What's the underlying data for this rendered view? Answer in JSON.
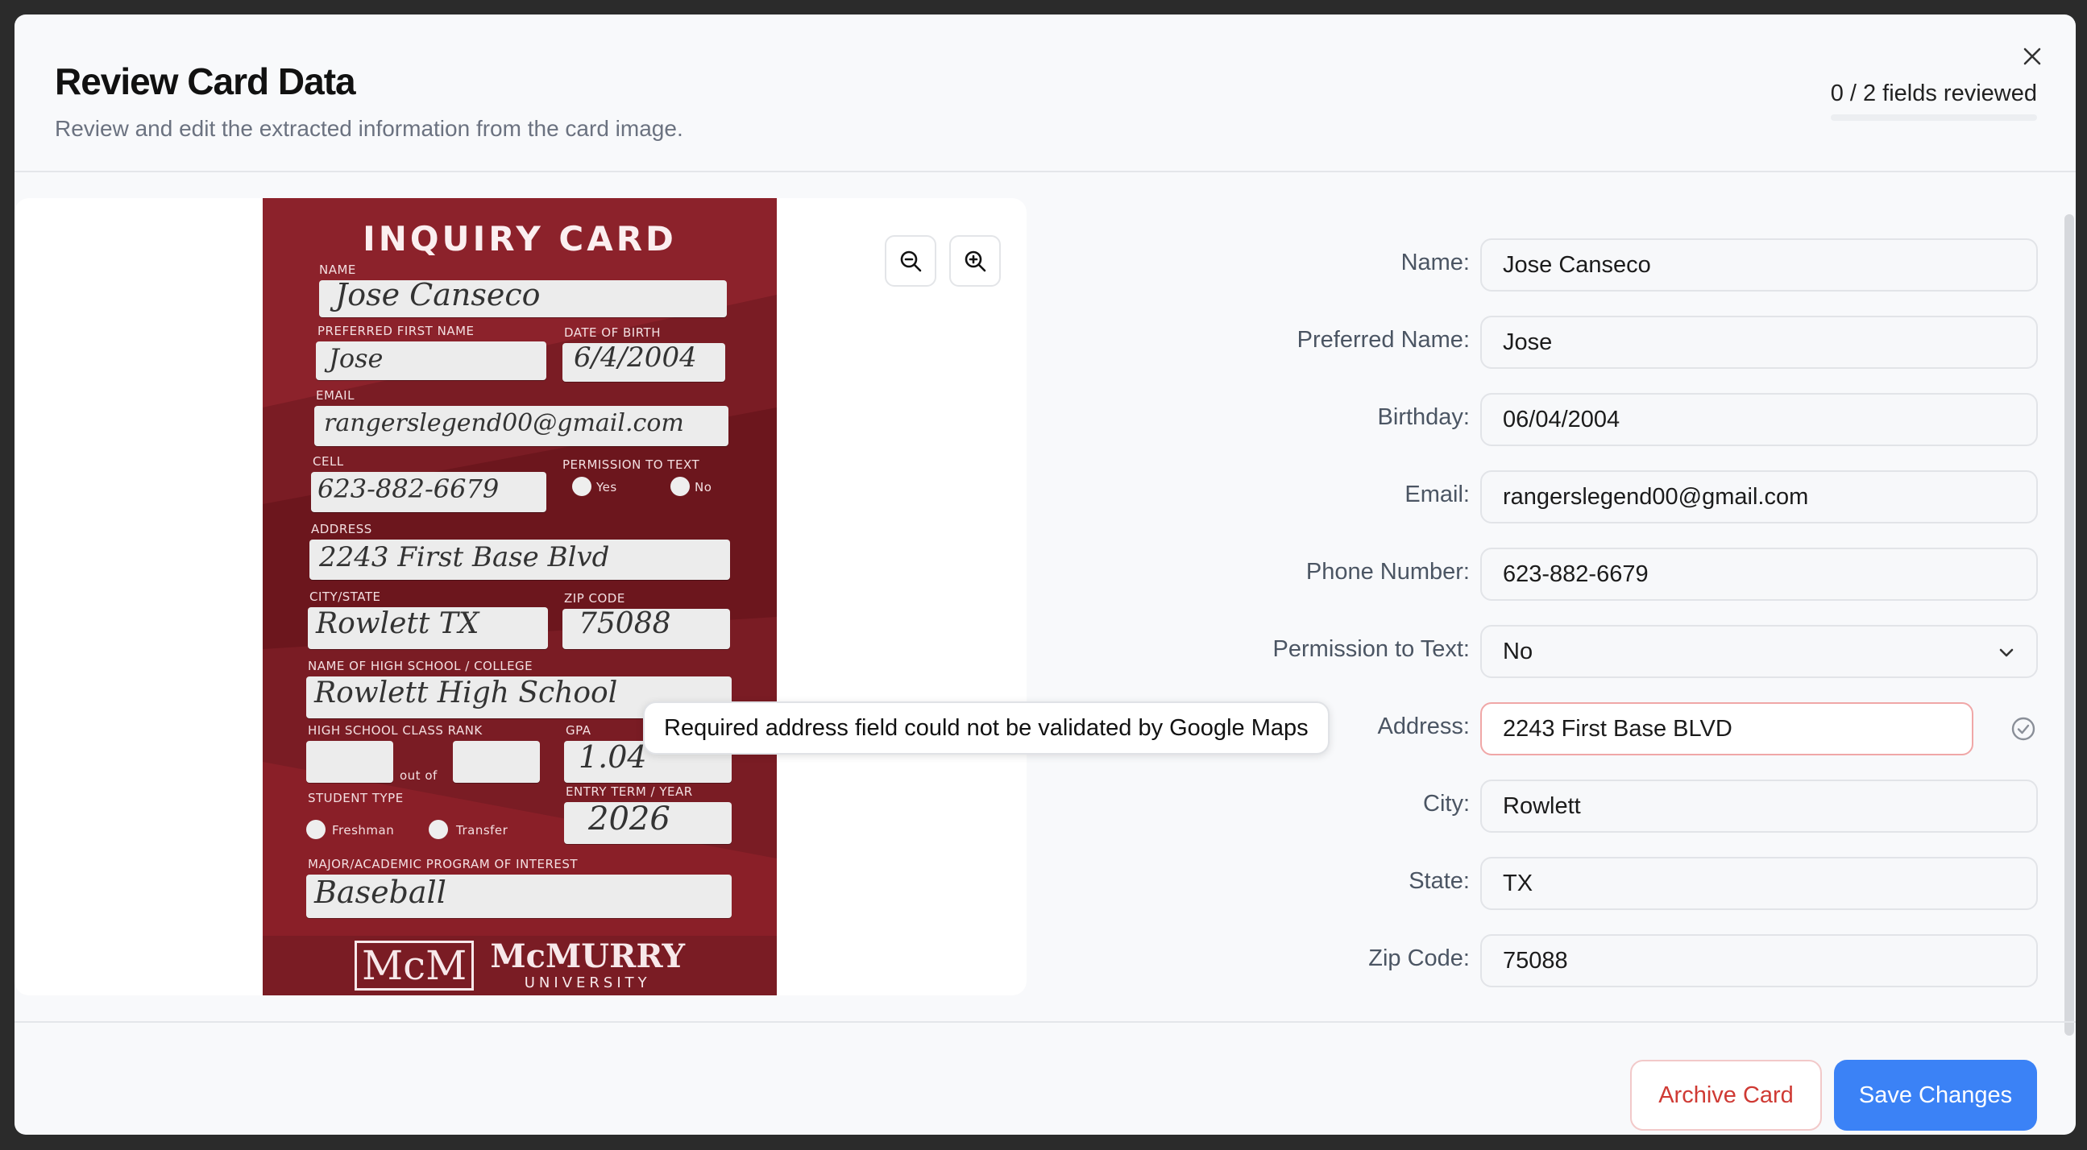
{
  "header": {
    "title": "Review Card Data",
    "subtitle": "Review and edit the extracted information from the card image.",
    "progress_text": "0 / 2 fields reviewed",
    "progress_fraction": 0
  },
  "card": {
    "title": "INQUIRY CARD",
    "labels": {
      "name": "NAME",
      "preferred": "PREFERRED FIRST NAME",
      "dob": "DATE OF BIRTH",
      "email": "EMAIL",
      "cell": "CELL",
      "permission": "PERMISSION TO TEXT",
      "yes": "Yes",
      "no": "No",
      "address": "ADDRESS",
      "city_state": "CITY/STATE",
      "zip": "ZIP CODE",
      "school": "NAME OF HIGH SCHOOL / COLLEGE",
      "rank": "HIGH SCHOOL CLASS RANK",
      "out_of": "out of",
      "gpa": "GPA",
      "student_type": "STUDENT TYPE",
      "entry": "ENTRY TERM / YEAR",
      "freshman": "Freshman",
      "transfer": "Transfer",
      "major": "MAJOR/ACADEMIC PROGRAM OF INTEREST",
      "logo_mark": "McM",
      "logo_name": "McMURRY",
      "logo_sub": "UNIVERSITY"
    },
    "handwriting": {
      "name": "Jose Canseco",
      "preferred": "Jose",
      "dob": "6/4/2004",
      "email": "rangerslegend00@gmail.com",
      "cell": "623-882-6679",
      "address": "2243 First Base Blvd",
      "city_state": "Rowlett TX",
      "zip": "75088",
      "school": "Rowlett High School",
      "gpa": "1.04",
      "entry": "2026",
      "major": "Baseball"
    }
  },
  "form": {
    "fields": [
      {
        "label": "Name:",
        "value": "Jose Canseco"
      },
      {
        "label": "Preferred Name:",
        "value": "Jose"
      },
      {
        "label": "Birthday:",
        "value": "06/04/2004"
      },
      {
        "label": "Email:",
        "value": "rangerslegend00@gmail.com"
      },
      {
        "label": "Phone Number:",
        "value": "623-882-6679"
      },
      {
        "label": "Permission to Text:",
        "value": "No"
      },
      {
        "label": "Address:",
        "value": "2243 First Base BLVD"
      },
      {
        "label": "City:",
        "value": "Rowlett"
      },
      {
        "label": "State:",
        "value": "TX"
      },
      {
        "label": "Zip Code:",
        "value": "75088"
      }
    ],
    "address_error_icon": "!",
    "address_tooltip": "Required address field could not be validated by Google Maps"
  },
  "footer": {
    "archive_label": "Archive Card",
    "save_label": "Save Changes"
  },
  "colors": {
    "primary": "#3b82f6",
    "danger": "#cf3a34",
    "error_border": "#f0a7a7",
    "card_maroon": "#7a1c24"
  },
  "icons": {
    "close": "close-icon",
    "zoom_out": "zoom-out-icon",
    "zoom_in": "zoom-in-icon",
    "chevron": "chevron-down-icon",
    "alert": "alert-circle-icon",
    "check": "check-circle-icon"
  }
}
